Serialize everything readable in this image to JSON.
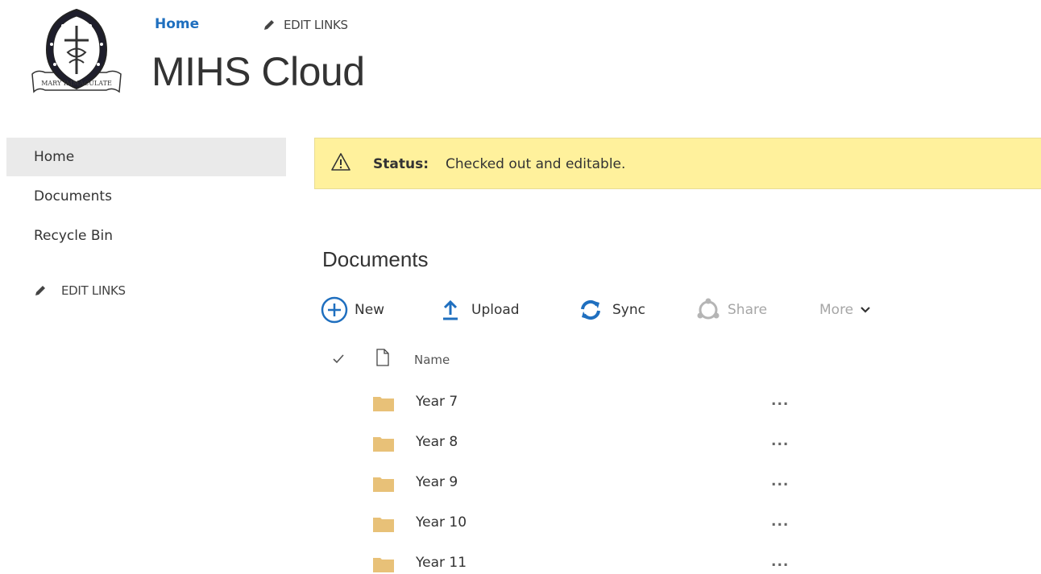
{
  "header": {
    "home_link": "Home",
    "edit_links": "EDIT LINKS",
    "site_title": "MIHS Cloud",
    "logo_text": "MARY IMMACULATE"
  },
  "nav": {
    "items": [
      {
        "label": "Home",
        "selected": true
      },
      {
        "label": "Documents",
        "selected": false
      },
      {
        "label": "Recycle Bin",
        "selected": false
      }
    ],
    "edit_links": "EDIT LINKS"
  },
  "status": {
    "label": "Status:",
    "text": "Checked out and editable.",
    "color": "#fff19c"
  },
  "documents": {
    "title": "Documents",
    "commands": {
      "new": "New",
      "upload": "Upload",
      "sync": "Sync",
      "share": "Share",
      "more": "More"
    },
    "column_name": "Name",
    "folders": [
      {
        "name": "Year 7",
        "menu": "..."
      },
      {
        "name": "Year 8",
        "menu": "..."
      },
      {
        "name": "Year 9",
        "menu": "..."
      },
      {
        "name": "Year 10",
        "menu": "..."
      },
      {
        "name": "Year 11",
        "menu": "..."
      }
    ]
  },
  "colors": {
    "accent": "#1f6fbf",
    "folder": "#e8c178",
    "nav_selected_bg": "#eaeaea"
  }
}
